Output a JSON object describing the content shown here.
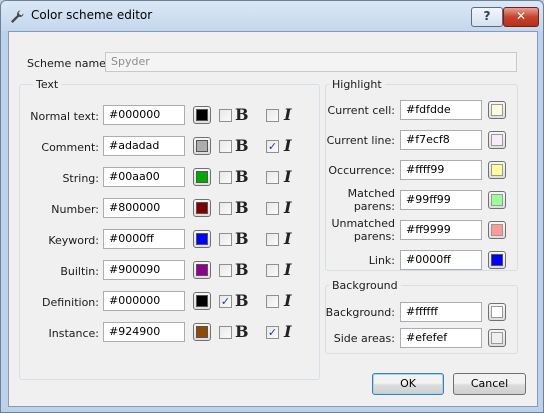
{
  "window": {
    "title": "Color scheme editor",
    "help_label": "?",
    "close_label": "✕"
  },
  "scheme": {
    "label": "Scheme name:",
    "value": "Spyder"
  },
  "text_group": {
    "title": "Text",
    "rows": [
      {
        "label": "Normal text:",
        "value": "#000000",
        "color": "#000000",
        "bold": false,
        "italic": false
      },
      {
        "label": "Comment:",
        "value": "#adadad",
        "color": "#adadad",
        "bold": false,
        "italic": true
      },
      {
        "label": "String:",
        "value": "#00aa00",
        "color": "#00aa00",
        "bold": false,
        "italic": false
      },
      {
        "label": "Number:",
        "value": "#800000",
        "color": "#800000",
        "bold": false,
        "italic": false
      },
      {
        "label": "Keyword:",
        "value": "#0000ff",
        "color": "#0000ff",
        "bold": false,
        "italic": false
      },
      {
        "label": "Builtin:",
        "value": "#900090",
        "color": "#900090",
        "bold": false,
        "italic": false
      },
      {
        "label": "Definition:",
        "value": "#000000",
        "color": "#000000",
        "bold": true,
        "italic": false
      },
      {
        "label": "Instance:",
        "value": "#924900",
        "color": "#924900",
        "bold": false,
        "italic": true
      }
    ],
    "bold_glyph": "B",
    "italic_glyph": "I"
  },
  "highlight_group": {
    "title": "Highlight",
    "rows": [
      {
        "label": "Current cell:",
        "value": "#fdfdde",
        "color": "#fdfdde"
      },
      {
        "label": "Current line:",
        "value": "#f7ecf8",
        "color": "#f7ecf8"
      },
      {
        "label": "Occurrence:",
        "value": "#ffff99",
        "color": "#ffff99"
      },
      {
        "label": "Matched\nparens:",
        "value": "#99ff99",
        "color": "#99ff99"
      },
      {
        "label": "Unmatched\nparens:",
        "value": "#ff9999",
        "color": "#ff9999"
      },
      {
        "label": "Link:",
        "value": "#0000ff",
        "color": "#0000ff"
      }
    ]
  },
  "background_group": {
    "title": "Background",
    "rows": [
      {
        "label": "Background:",
        "value": "#ffffff",
        "color": "#ffffff"
      },
      {
        "label": "Side areas:",
        "value": "#efefef",
        "color": "#efefef"
      }
    ]
  },
  "buttons": {
    "ok": "OK",
    "cancel": "Cancel"
  }
}
